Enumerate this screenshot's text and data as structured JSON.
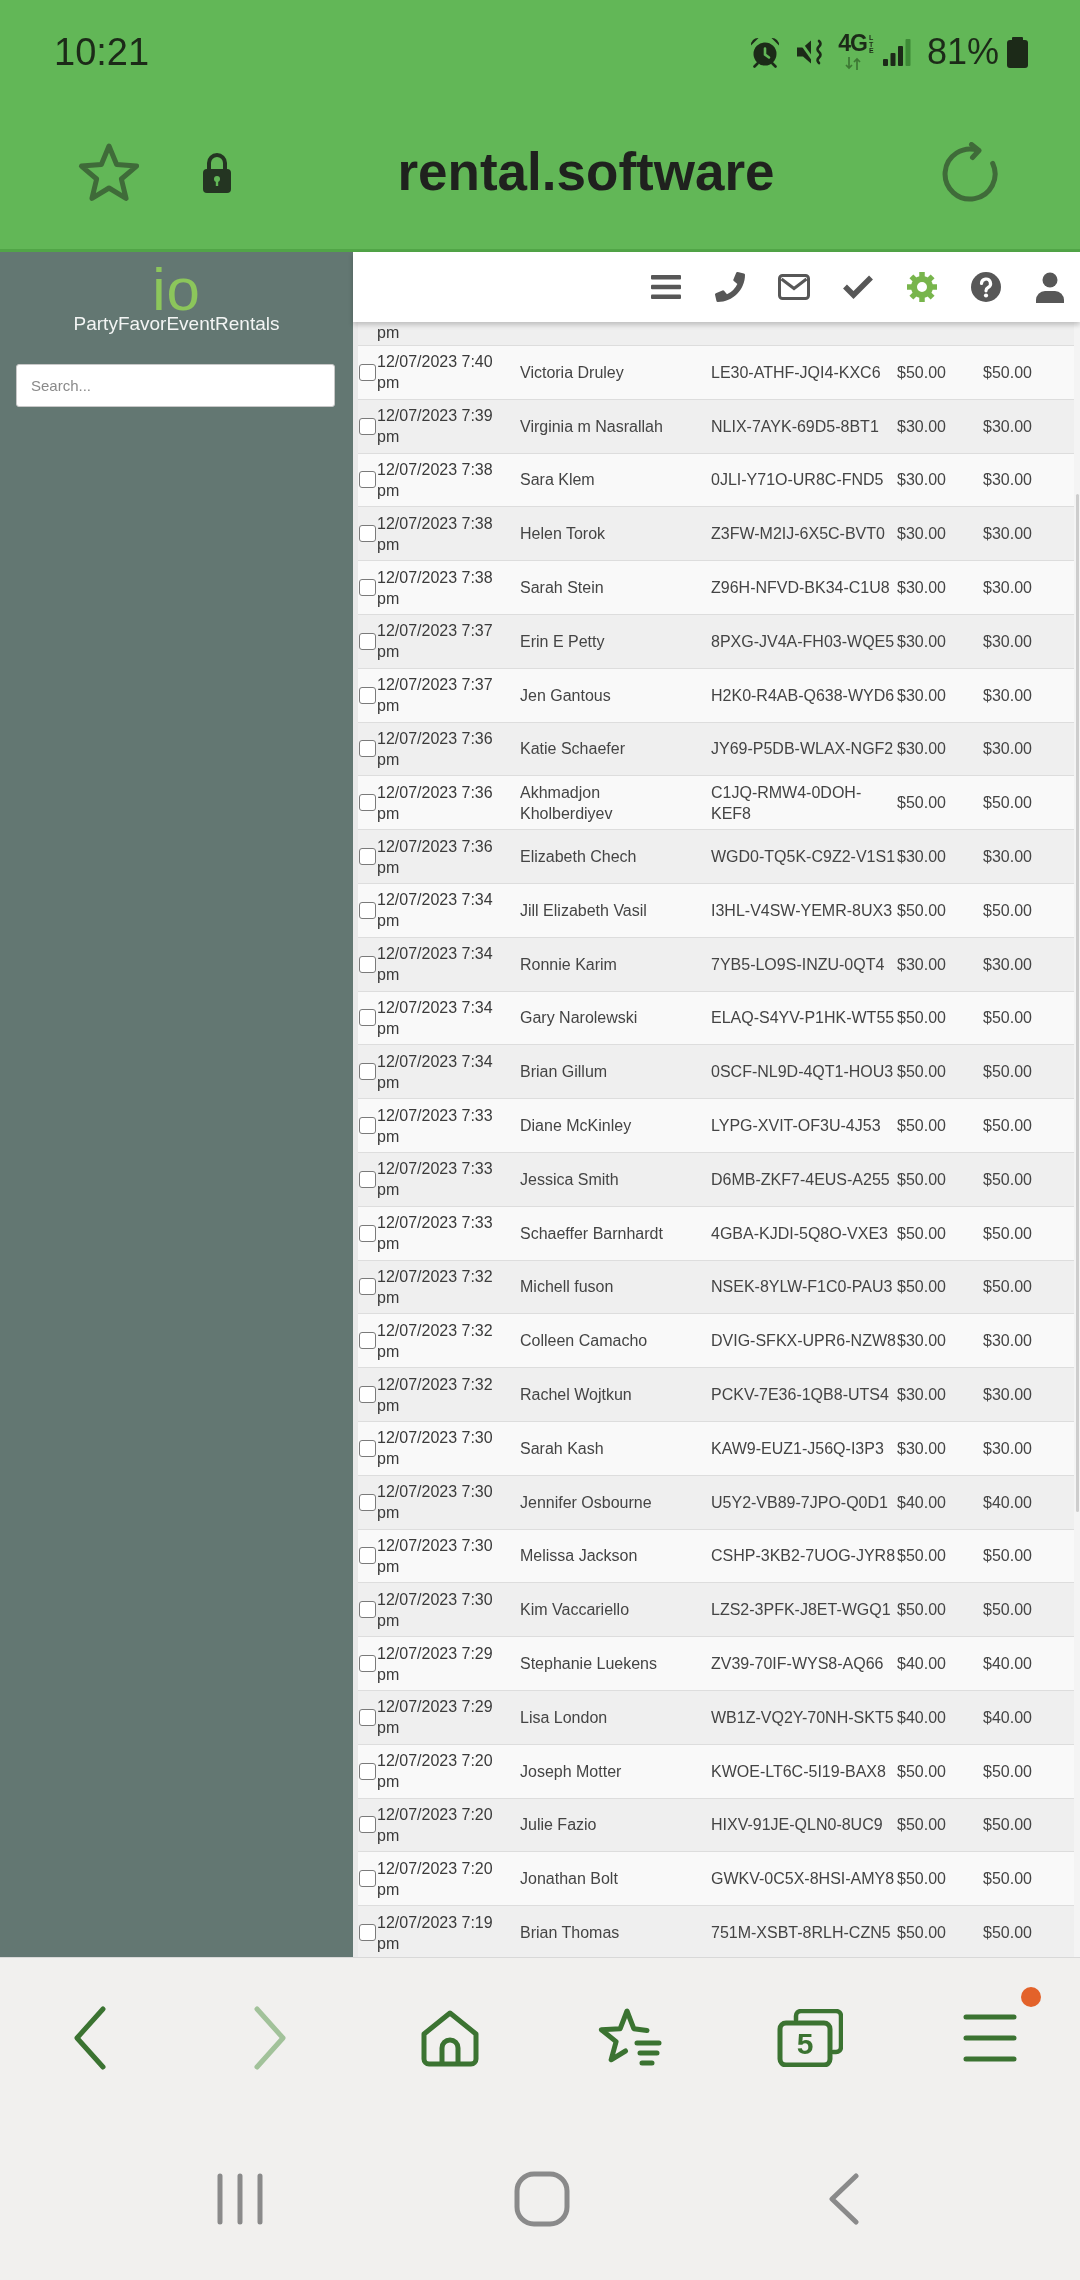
{
  "status_bar": {
    "time": "10:21",
    "network": "4G",
    "network_badge": "LTE",
    "battery": "81%"
  },
  "address_bar": {
    "url": "rental.software"
  },
  "sidebar": {
    "logo": "io",
    "company": "PartyFavorEventRentals",
    "search": {
      "placeholder": "Search..."
    }
  },
  "toolbar": {
    "items": [
      {
        "kind": "menu",
        "selected": false
      },
      {
        "kind": "phone",
        "selected": false
      },
      {
        "kind": "mail",
        "selected": false
      },
      {
        "kind": "check",
        "selected": false
      },
      {
        "kind": "settings",
        "selected": true
      },
      {
        "kind": "help",
        "selected": false
      },
      {
        "kind": "user",
        "selected": false
      }
    ]
  },
  "table": {
    "cut_row": {
      "cells": [
        "pm"
      ]
    },
    "rows": [
      {
        "checked": false,
        "cells": [
          "12/07/2023 7:40 pm",
          "Victoria Druley",
          "LE30-ATHF-JQI4-KXC6",
          "$50.00",
          "$50.00"
        ]
      },
      {
        "checked": false,
        "cells": [
          "12/07/2023 7:39 pm",
          "Virginia m Nasrallah",
          "NLIX-7AYK-69D5-8BT1",
          "$30.00",
          "$30.00"
        ]
      },
      {
        "checked": false,
        "cells": [
          "12/07/2023 7:38 pm",
          "Sara Klem",
          "0JLI-Y71O-UR8C-FND5",
          "$30.00",
          "$30.00"
        ]
      },
      {
        "checked": false,
        "cells": [
          "12/07/2023 7:38 pm",
          "Helen Torok",
          "Z3FW-M2IJ-6X5C-BVT0",
          "$30.00",
          "$30.00"
        ]
      },
      {
        "checked": false,
        "cells": [
          "12/07/2023 7:38 pm",
          "Sarah Stein",
          "Z96H-NFVD-BK34-C1U8",
          "$30.00",
          "$30.00"
        ]
      },
      {
        "checked": false,
        "cells": [
          "12/07/2023 7:37 pm",
          "Erin E Petty",
          "8PXG-JV4A-FH03-WQE5",
          "$30.00",
          "$30.00"
        ]
      },
      {
        "checked": false,
        "cells": [
          "12/07/2023 7:37 pm",
          "Jen Gantous",
          "H2K0-R4AB-Q638-WYD6",
          "$30.00",
          "$30.00"
        ]
      },
      {
        "checked": false,
        "cells": [
          "12/07/2023 7:36 pm",
          "Katie Schaefer",
          "JY69-P5DB-WLAX-NGF2",
          "$30.00",
          "$30.00"
        ]
      },
      {
        "checked": false,
        "cells": [
          "12/07/2023 7:36 pm",
          "Akhmadjon Kholberdiyev",
          "C1JQ-RMW4-0DOH-KEF8",
          "$50.00",
          "$50.00"
        ]
      },
      {
        "checked": false,
        "cells": [
          "12/07/2023 7:36 pm",
          "Elizabeth Chech",
          "WGD0-TQ5K-C9Z2-V1S1",
          "$30.00",
          "$30.00"
        ]
      },
      {
        "checked": false,
        "cells": [
          "12/07/2023 7:34 pm",
          "Jill Elizabeth Vasil",
          "I3HL-V4SW-YEMR-8UX3",
          "$50.00",
          "$50.00"
        ]
      },
      {
        "checked": false,
        "cells": [
          "12/07/2023 7:34 pm",
          "Ronnie Karim",
          "7YB5-LO9S-INZU-0QT4",
          "$30.00",
          "$30.00"
        ]
      },
      {
        "checked": false,
        "cells": [
          "12/07/2023 7:34 pm",
          "Gary Narolewski",
          "ELAQ-S4YV-P1HK-WT55",
          "$50.00",
          "$50.00"
        ]
      },
      {
        "checked": false,
        "cells": [
          "12/07/2023 7:34 pm",
          "Brian Gillum",
          "0SCF-NL9D-4QT1-HOU3",
          "$50.00",
          "$50.00"
        ]
      },
      {
        "checked": false,
        "cells": [
          "12/07/2023 7:33 pm",
          "Diane McKinley",
          "LYPG-XVIT-OF3U-4J53",
          "$50.00",
          "$50.00"
        ]
      },
      {
        "checked": false,
        "cells": [
          "12/07/2023 7:33 pm",
          "Jessica Smith",
          "D6MB-ZKF7-4EUS-A255",
          "$50.00",
          "$50.00"
        ]
      },
      {
        "checked": false,
        "cells": [
          "12/07/2023 7:33 pm",
          "Schaeffer Barnhardt",
          "4GBA-KJDI-5Q8O-VXE3",
          "$50.00",
          "$50.00"
        ]
      },
      {
        "checked": false,
        "cells": [
          "12/07/2023 7:32 pm",
          "Michell fuson",
          "NSEK-8YLW-F1C0-PAU3",
          "$50.00",
          "$50.00"
        ]
      },
      {
        "checked": false,
        "cells": [
          "12/07/2023 7:32 pm",
          "Colleen Camacho",
          "DVIG-SFKX-UPR6-NZW8",
          "$30.00",
          "$30.00"
        ]
      },
      {
        "checked": false,
        "cells": [
          "12/07/2023 7:32 pm",
          "Rachel Wojtkun",
          "PCKV-7E36-1QB8-UTS4",
          "$30.00",
          "$30.00"
        ]
      },
      {
        "checked": false,
        "cells": [
          "12/07/2023 7:30 pm",
          "Sarah Kash",
          "KAW9-EUZ1-J56Q-I3P3",
          "$30.00",
          "$30.00"
        ]
      },
      {
        "checked": false,
        "cells": [
          "12/07/2023 7:30 pm",
          "Jennifer Osbourne",
          "U5Y2-VB89-7JPO-Q0D1",
          "$40.00",
          "$40.00"
        ]
      },
      {
        "checked": false,
        "cells": [
          "12/07/2023 7:30 pm",
          "Melissa Jackson",
          "CSHP-3KB2-7UOG-JYR8",
          "$50.00",
          "$50.00"
        ]
      },
      {
        "checked": false,
        "cells": [
          "12/07/2023 7:30 pm",
          "Kim Vaccariello",
          "LZS2-3PFK-J8ET-WGQ1",
          "$50.00",
          "$50.00"
        ]
      },
      {
        "checked": false,
        "cells": [
          "12/07/2023 7:29 pm",
          "Stephanie Luekens",
          "ZV39-70IF-WYS8-AQ66",
          "$40.00",
          "$40.00"
        ]
      },
      {
        "checked": false,
        "cells": [
          "12/07/2023 7:29 pm",
          "Lisa London",
          "WB1Z-VQ2Y-70NH-SKT5",
          "$40.00",
          "$40.00"
        ]
      },
      {
        "checked": false,
        "cells": [
          "12/07/2023 7:20 pm",
          "Joseph Motter",
          "KWOE-LT6C-5I19-BAX8",
          "$50.00",
          "$50.00"
        ]
      },
      {
        "checked": false,
        "cells": [
          "12/07/2023 7:20 pm",
          "Julie Fazio",
          "HIXV-91JE-QLN0-8UC9",
          "$50.00",
          "$50.00"
        ]
      },
      {
        "checked": false,
        "cells": [
          "12/07/2023 7:20 pm",
          "Jonathan Bolt",
          "GWKV-0C5X-8HSI-AMY8",
          "$50.00",
          "$50.00"
        ]
      },
      {
        "checked": false,
        "cells": [
          "12/07/2023 7:19 pm",
          "Brian Thomas",
          "751M-XSBT-8RLH-CZN5",
          "$50.00",
          "$50.00"
        ]
      }
    ]
  },
  "bottom_nav": {
    "items": [
      {
        "kind": "back",
        "disabled": false,
        "badge": false
      },
      {
        "kind": "forward",
        "disabled": true,
        "badge": false
      },
      {
        "kind": "home",
        "disabled": false,
        "badge": false
      },
      {
        "kind": "bookmarks",
        "disabled": false,
        "badge": false
      },
      {
        "kind": "tabs",
        "count": "5",
        "disabled": false,
        "badge": false
      },
      {
        "kind": "menu",
        "disabled": false,
        "badge": true
      }
    ]
  },
  "system_nav": {
    "items": [
      {
        "kind": "recents"
      },
      {
        "kind": "home"
      },
      {
        "kind": "back"
      }
    ]
  }
}
